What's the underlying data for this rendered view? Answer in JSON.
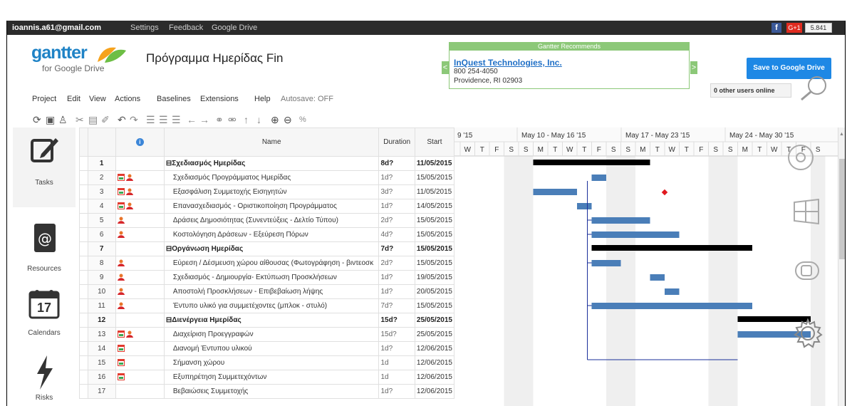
{
  "topbar": {
    "account": "ioannis.a61@gmail.com",
    "links": [
      "Settings",
      "Feedback",
      "Google Drive"
    ],
    "facebook_label": "f",
    "gplus_label": "G+1",
    "share_count": "5.841"
  },
  "header": {
    "logo_text": "gantter",
    "logo_sub": "for Google Drive",
    "doc_title": "Πρόγραμμα Ημερίδας Fin"
  },
  "recommend": {
    "title": "Gantter Recommends",
    "name": "InQuest Technologies, Inc.",
    "phone": "800 254-4050",
    "address": "Providence, RI 02903",
    "prev_label": "<",
    "next_label": ">"
  },
  "save_label": "Save to Google Drive",
  "online_label": "0 other users online",
  "menu": [
    "Project",
    "Edit",
    "View",
    "Actions",
    "Baselines",
    "Extensions",
    "Help"
  ],
  "autosave": "Autosave: OFF",
  "sidebar": [
    {
      "label": "Tasks",
      "icon": "edit-icon"
    },
    {
      "label": "Resources",
      "icon": "address-book-icon"
    },
    {
      "label": "Calendars",
      "icon": "calendar-icon",
      "day": "17"
    },
    {
      "label": "Risks",
      "icon": "lightning-icon"
    }
  ],
  "grid": {
    "headers": {
      "info": "i",
      "name": "Name",
      "duration": "Duration",
      "start": "Start"
    },
    "rows": [
      {
        "n": "1",
        "icons": "",
        "name": "Σχεδιασμός Ημερίδας",
        "dur": "8d?",
        "start": "11/05/2015",
        "summary": true
      },
      {
        "n": "2",
        "icons": "cal-person",
        "name": "Σχεδιασμός Προγράμματος Ημερίδας",
        "dur": "1d?",
        "start": "15/05/2015",
        "summary": false
      },
      {
        "n": "3",
        "icons": "cal-person",
        "name": "Εξασφάλιση Συμμετοχής Εισηγητών",
        "dur": "3d?",
        "start": "11/05/2015",
        "summary": false
      },
      {
        "n": "4",
        "icons": "cal-person",
        "name": "Επανασχεδιασμός - Οριστικοποίηση Προγράμματος",
        "dur": "1d?",
        "start": "14/05/2015",
        "summary": false
      },
      {
        "n": "5",
        "icons": "person",
        "name": "Δράσεις Δημοσιότητας (Συνεντεύξεις - Δελτίο Τύπου)",
        "dur": "2d?",
        "start": "15/05/2015",
        "summary": false
      },
      {
        "n": "6",
        "icons": "person",
        "name": "Κοστολόγηση Δράσεων - Εξεύρεση Πόρων",
        "dur": "4d?",
        "start": "15/05/2015",
        "summary": false
      },
      {
        "n": "7",
        "icons": "",
        "name": "Οργάνωση Ημερίδας",
        "dur": "7d?",
        "start": "15/05/2015",
        "summary": true
      },
      {
        "n": "8",
        "icons": "person",
        "name": "Εύρεση / Δέσμευση χώρου αίθουσας (Φωτογράφηση - βιντεοσκ",
        "dur": "2d?",
        "start": "15/05/2015",
        "summary": false
      },
      {
        "n": "9",
        "icons": "person",
        "name": "Σχεδιασμός - Δημιουργία- Εκτύπωση Προσκλήσεων",
        "dur": "1d?",
        "start": "19/05/2015",
        "summary": false
      },
      {
        "n": "10",
        "icons": "person",
        "name": "Αποστολή Προσκλήσεων - Επιβεβαίωση λήψης",
        "dur": "1d?",
        "start": "20/05/2015",
        "summary": false
      },
      {
        "n": "11",
        "icons": "person",
        "name": "Έντυπο υλικό για συμμετέχοντες (μπλοκ - στυλό)",
        "dur": "7d?",
        "start": "15/05/2015",
        "summary": false
      },
      {
        "n": "12",
        "icons": "",
        "name": "Διενέργεια Ημερίδας",
        "dur": "15d?",
        "start": "25/05/2015",
        "summary": true
      },
      {
        "n": "13",
        "icons": "cal-person",
        "name": "Διαχείριση Προεγγραφών",
        "dur": "15d?",
        "start": "25/05/2015",
        "summary": false
      },
      {
        "n": "14",
        "icons": "cal",
        "name": "Διανομή Έντυπου υλικού",
        "dur": "1d?",
        "start": "12/06/2015",
        "summary": false
      },
      {
        "n": "15",
        "icons": "cal",
        "name": "Σήμανση χώρου",
        "dur": "1d",
        "start": "12/06/2015",
        "summary": false
      },
      {
        "n": "16",
        "icons": "cal",
        "name": "Εξυπηρέτηση Συμμετεχόντων",
        "dur": "1d",
        "start": "12/06/2015",
        "summary": false
      },
      {
        "n": "17",
        "icons": "",
        "name": "Βεβαιώσεις Συμμετοχής",
        "dur": "1d?",
        "start": "12/06/2015",
        "summary": false
      }
    ]
  },
  "gantt": {
    "weeks": [
      "9 '15",
      "May 10 - May 16 '15",
      "May 17 - May 23 '15",
      "May 24 - May 30 '15"
    ],
    "days": [
      "W",
      "T",
      "F",
      "S",
      "S",
      "M",
      "T",
      "W",
      "T",
      "F",
      "S",
      "S",
      "M",
      "T",
      "W",
      "T",
      "F",
      "S",
      "S",
      "M",
      "T",
      "W",
      "T",
      "F",
      "S"
    ],
    "chart_start": "2015-05-06",
    "bars": [
      {
        "row": 1,
        "start": "2015-05-11",
        "days": 8,
        "kind": "summary"
      },
      {
        "row": 2,
        "start": "2015-05-15",
        "days": 1,
        "kind": "task"
      },
      {
        "row": 3,
        "start": "2015-05-11",
        "days": 3,
        "kind": "task"
      },
      {
        "row": 3,
        "start": "2015-05-20",
        "days": 0,
        "kind": "milestone"
      },
      {
        "row": 4,
        "start": "2015-05-14",
        "days": 1,
        "kind": "task"
      },
      {
        "row": 5,
        "start": "2015-05-15",
        "days": 4,
        "kind": "task"
      },
      {
        "row": 6,
        "start": "2015-05-15",
        "days": 6,
        "kind": "task"
      },
      {
        "row": 7,
        "start": "2015-05-15",
        "days": 11,
        "kind": "summary"
      },
      {
        "row": 8,
        "start": "2015-05-15",
        "days": 2,
        "kind": "task"
      },
      {
        "row": 9,
        "start": "2015-05-19",
        "days": 1,
        "kind": "task"
      },
      {
        "row": 10,
        "start": "2015-05-20",
        "days": 1,
        "kind": "task"
      },
      {
        "row": 11,
        "start": "2015-05-15",
        "days": 11,
        "kind": "summary-task"
      },
      {
        "row": 12,
        "start": "2015-05-25",
        "days": 5,
        "kind": "summary"
      },
      {
        "row": 13,
        "start": "2015-05-25",
        "days": 5,
        "kind": "task"
      }
    ]
  },
  "colors": {
    "accent": "#1e88e5",
    "topbar": "#2b2b2b",
    "bar": "#4a7eb8",
    "summary_bar": "#000000",
    "milestone": "#e0191f",
    "recommend": "#8cc878"
  }
}
